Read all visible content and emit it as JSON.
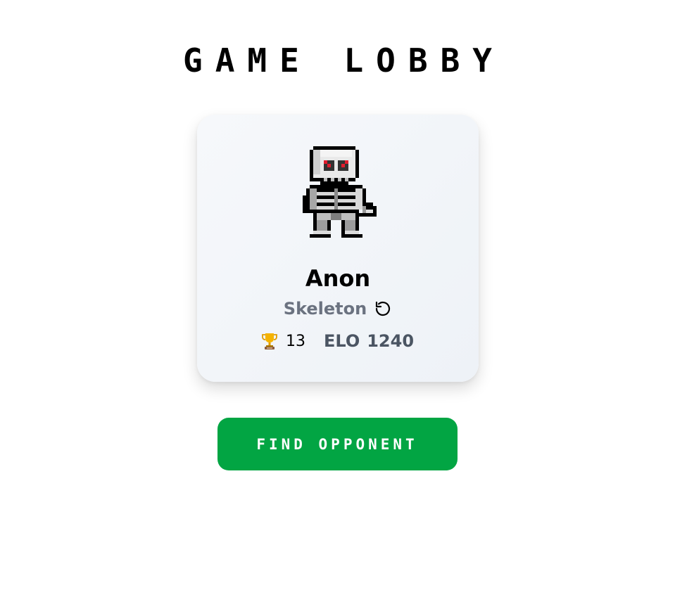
{
  "lobby": {
    "title": "GAME LOBBY"
  },
  "player": {
    "name": "Anon",
    "character_class": "Skeleton",
    "trophies": "13",
    "elo_label": "ELO",
    "elo_value": "1240",
    "avatar_icon": "skeleton-sprite",
    "reroll_icon": "rotate-ccw-icon",
    "trophy_icon": "trophy-icon"
  },
  "actions": {
    "find_opponent_label": "FIND OPPONENT"
  },
  "colors": {
    "button_bg": "#02a543",
    "card_bg": "#f1f4f8",
    "class_text": "#6b7280",
    "elo_text": "#4b5563",
    "sprite_eye": "#e11d2e"
  }
}
